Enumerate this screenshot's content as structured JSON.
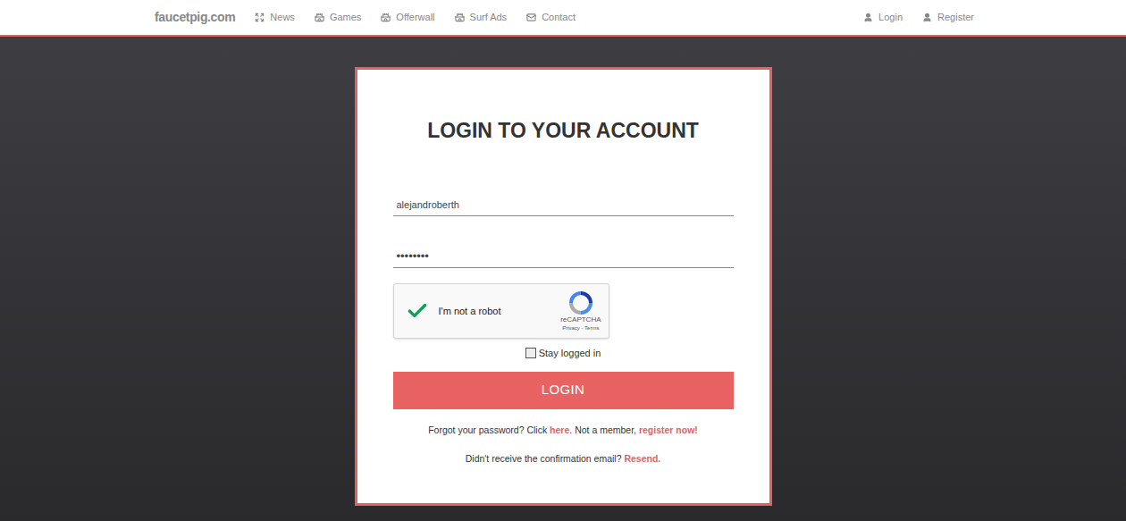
{
  "nav": {
    "brand": "faucetpig.com",
    "items": [
      {
        "label": "News"
      },
      {
        "label": "Games"
      },
      {
        "label": "Offerwall"
      },
      {
        "label": "Surf Ads"
      },
      {
        "label": "Contact"
      }
    ],
    "auth": [
      {
        "label": "Login"
      },
      {
        "label": "Register"
      }
    ]
  },
  "form": {
    "title": "LOGIN TO YOUR ACCOUNT",
    "username": "alejandroberth",
    "password": "••••••••",
    "captcha": {
      "label": "I'm not a robot",
      "brand": "reCAPTCHA",
      "links": "Privacy - Terms",
      "checked": true
    },
    "stay_logged_in": {
      "label": "Stay logged in",
      "checked": false
    },
    "button": "LOGIN",
    "help": [
      {
        "parts": [
          {
            "text": "Forgot your password? Click ",
            "link": false
          },
          {
            "text": "here",
            "link": true
          },
          {
            "text": ". Not a member, ",
            "link": false
          },
          {
            "text": "register now!",
            "link": true
          }
        ]
      },
      {
        "parts": [
          {
            "text": "Didn't receive the confirmation email? ",
            "link": false
          },
          {
            "text": "Resend.",
            "link": true
          }
        ]
      }
    ]
  }
}
